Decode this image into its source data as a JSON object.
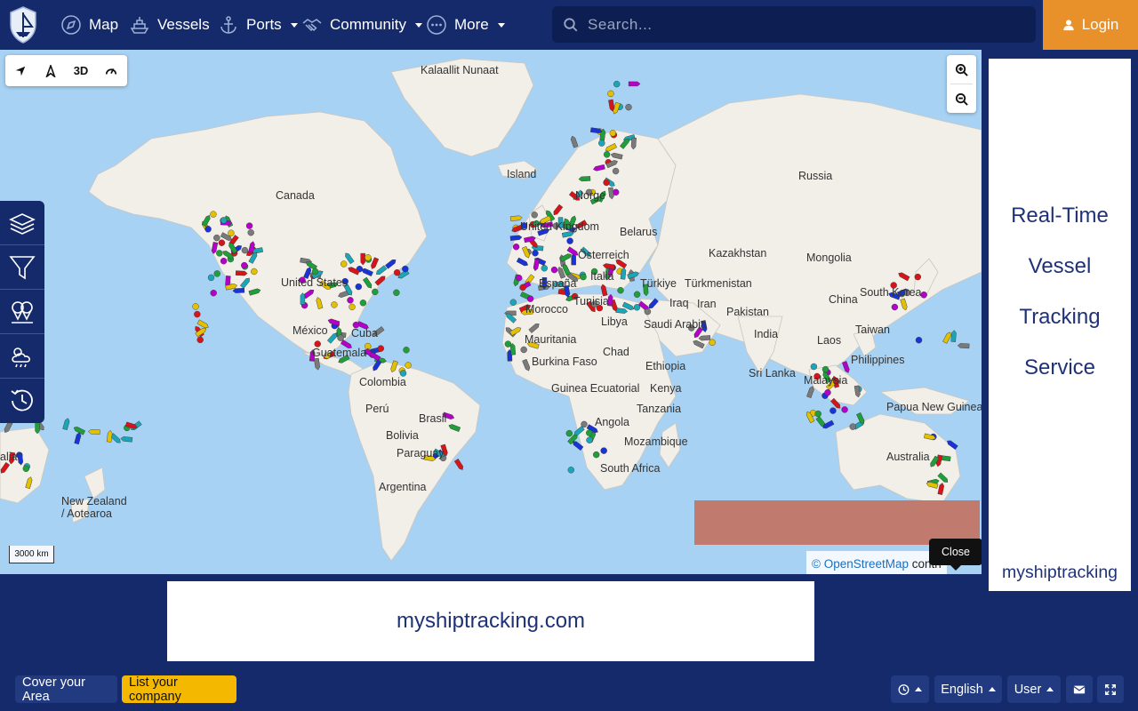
{
  "navbar": {
    "nav": [
      {
        "label": "Map",
        "icon": "compass-icon",
        "dropdown": false
      },
      {
        "label": "Vessels",
        "icon": "ship-icon",
        "dropdown": false
      },
      {
        "label": "Ports",
        "icon": "anchor-icon",
        "dropdown": true
      },
      {
        "label": "Community",
        "icon": "handshake-icon",
        "dropdown": true
      },
      {
        "label": "More",
        "icon": "dots-icon",
        "dropdown": true
      }
    ],
    "search_placeholder": "Search...",
    "login_label": "Login"
  },
  "map": {
    "toolbar": {
      "three_d": "3D"
    },
    "labels": [
      "Kalaallit Nunaat",
      "Russia",
      "Canada",
      "Island",
      "Norge",
      "United Kingdom",
      "Belarus",
      "Kazakhstan",
      "Mongolia",
      "Österreich",
      "United States",
      "España",
      "Italia",
      "Türkiye",
      "Türkmenistan",
      "China",
      "South Korea",
      "Morocco",
      "Tunisia",
      "Iraq",
      "Iran",
      "Pakistan",
      "México",
      "Cuba",
      "Libya",
      "Saudi Arabia",
      "India",
      "Laos",
      "Taiwan",
      "Guatemala",
      "Mauritania",
      "Chad",
      "Philippines",
      "Burkina Faso",
      "Ethiopia",
      "Sri Lanka",
      "Malaysia",
      "Colombia",
      "Guinea Ecuatorial",
      "Kenya",
      "Papua New Guinea",
      "Guinea",
      "Perú",
      "Brasil",
      "Tanzania",
      "Bolivia",
      "Angola",
      "Mozambique",
      "Australia",
      "Paraguay",
      "South Africa",
      "Argentina",
      "New Zealand / Aotearoa",
      "alia"
    ],
    "scale": "3000 km",
    "attribution_link": "© OpenStreetMap",
    "attribution_rest": "contri",
    "tooltip": "Close"
  },
  "right_ad": {
    "lines": [
      "Real-Time",
      "Vessel",
      "Tracking",
      "Service"
    ],
    "brand": "myshiptracking"
  },
  "bottom_ad": {
    "text": "myshiptracking.com"
  },
  "footer": {
    "cover_area": "Cover your Area",
    "list_company": "List your company",
    "language": "English",
    "user": "User"
  },
  "colors": {
    "navy": "#152a6b",
    "login_orange": "#e8912a",
    "list_company_yellow": "#f5b800",
    "sea": "#a8d2f3",
    "land": "#f2efe9"
  }
}
